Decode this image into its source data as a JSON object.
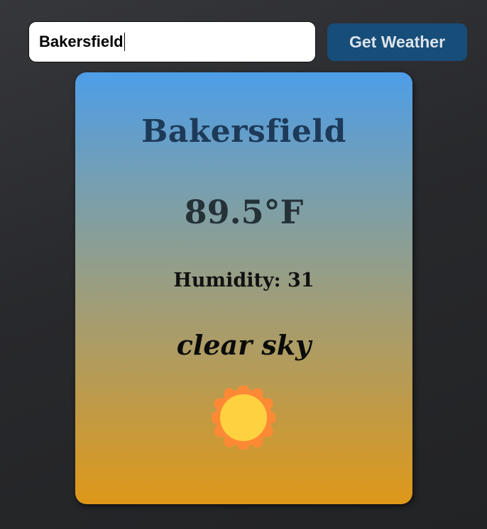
{
  "search": {
    "value": "Bakersfield",
    "button_label": "Get Weather"
  },
  "weather": {
    "city": "Bakersfield",
    "temperature": "89.5°F",
    "humidity": "Humidity: 31",
    "description": "clear sky",
    "icon": "sun-icon"
  },
  "colors": {
    "button_bg": "#164d79",
    "card_gradient_top": "#4e9ee8",
    "card_gradient_bottom": "#de9819",
    "sun_core": "#fdd13f",
    "sun_rays": "#fc8a35"
  }
}
